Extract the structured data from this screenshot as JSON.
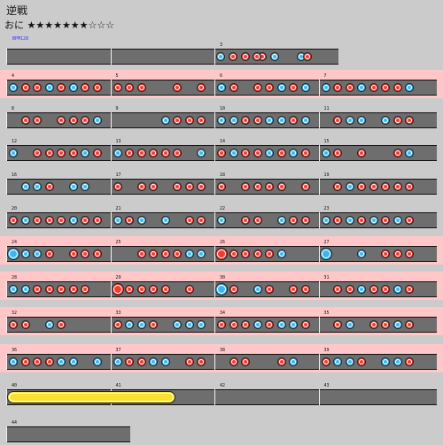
{
  "song": {
    "title": "逆戦",
    "difficulty_label": "おに",
    "stars": "★★★★★★★☆☆☆"
  },
  "bpm_label": "BPM128",
  "rows": [
    {
      "gogo": false,
      "measures": [
        "",
        "",
        "3"
      ],
      "pattern": "0000 0000 0000 0000 | 0000 0000 0000 0000 | 1010 1000 1022 2000",
      "cols": [
        0,
        1,
        2
      ]
    },
    {
      "gogo": true,
      "measures": [
        "4",
        "5",
        "6",
        "7"
      ],
      "pattern": "r"
    },
    {
      "gogo": false,
      "measures": [
        "8",
        "9",
        "10",
        "11"
      ],
      "pattern": "r"
    },
    {
      "gogo": false,
      "measures": [
        "12",
        "13",
        "14",
        "15"
      ],
      "pattern": "r"
    },
    {
      "gogo": false,
      "measures": [
        "16",
        "17",
        "18",
        "19"
      ],
      "pattern": "r"
    },
    {
      "gogo": false,
      "measures": [
        "20",
        "21",
        "22",
        "23"
      ],
      "pattern": "r"
    },
    {
      "gogo": true,
      "measures": [
        "24",
        "25",
        "26",
        "27"
      ],
      "pattern": "r"
    },
    {
      "gogo": true,
      "measures": [
        "28",
        "29",
        "30",
        "31"
      ],
      "pattern": "r"
    },
    {
      "gogo": true,
      "measures": [
        "32",
        "33",
        "34",
        "35"
      ],
      "pattern": "r"
    },
    {
      "gogo": true,
      "measures": [
        "36",
        "37",
        "38",
        "39"
      ],
      "pattern": "r"
    },
    {
      "gogo": false,
      "measures": [
        "40",
        "41",
        "42",
        "43"
      ],
      "pattern": "roll"
    },
    {
      "gogo": false,
      "measures": [
        "44"
      ],
      "pattern": "end"
    }
  ]
}
